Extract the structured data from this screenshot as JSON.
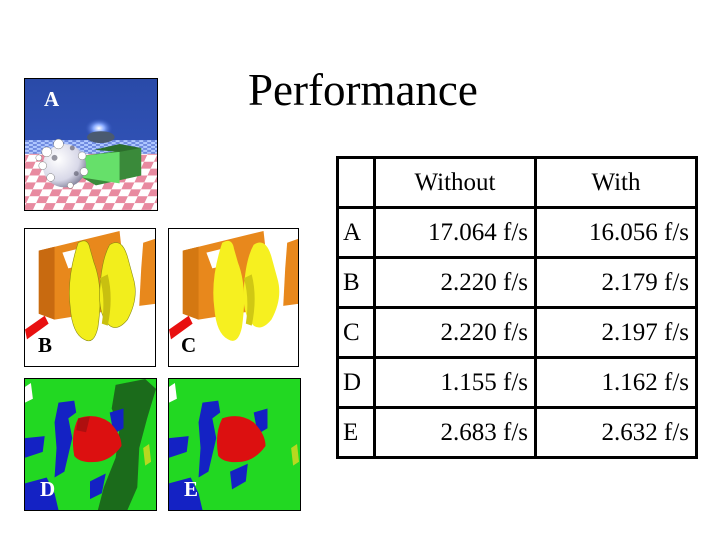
{
  "title": "Performance",
  "thumbnails": [
    {
      "id": "A",
      "label": "A",
      "label_color": "#ffffff",
      "description": "ray-traced scene: fractal spheres, green box, mirror ball on pink checkerboard"
    },
    {
      "id": "B",
      "label": "B",
      "label_color": "#000000",
      "description": "orange and yellow 3D surface model with red tube"
    },
    {
      "id": "C",
      "label": "C",
      "label_color": "#000000",
      "description": "orange and yellow 3D surface model with red tube (smoothed)"
    },
    {
      "id": "D",
      "label": "D",
      "label_color": "#ffffff",
      "description": "terrain map: green land, blue water, red region, dark green strip"
    },
    {
      "id": "E",
      "label": "E",
      "label_color": "#ffffff",
      "description": "terrain map: green land, blue water, red region"
    }
  ],
  "table": {
    "headers": [
      "",
      "Without",
      "With"
    ],
    "rows": [
      {
        "label": "A",
        "without": "17.064 f/s",
        "with": "16.056 f/s"
      },
      {
        "label": "B",
        "without": "2.220 f/s",
        "with": "2.179 f/s"
      },
      {
        "label": "C",
        "without": "2.220 f/s",
        "with": "2.197 f/s"
      },
      {
        "label": "D",
        "without": "1.155 f/s",
        "with": "1.162 f/s"
      },
      {
        "label": "E",
        "without": "2.683 f/s",
        "with": "2.632 f/s"
      }
    ]
  },
  "colors": {
    "sky_blue": "#2f4fae",
    "checker_pink": "#e88aa0",
    "box_green": "#3fbf4f",
    "surface_orange": "#e8881c",
    "surface_yellow": "#f2ee1c",
    "tube_red": "#e81010",
    "land_green": "#22d822",
    "water_blue": "#1422c4",
    "region_red": "#dc1010",
    "forest_dark_green": "#1b6b1b"
  }
}
